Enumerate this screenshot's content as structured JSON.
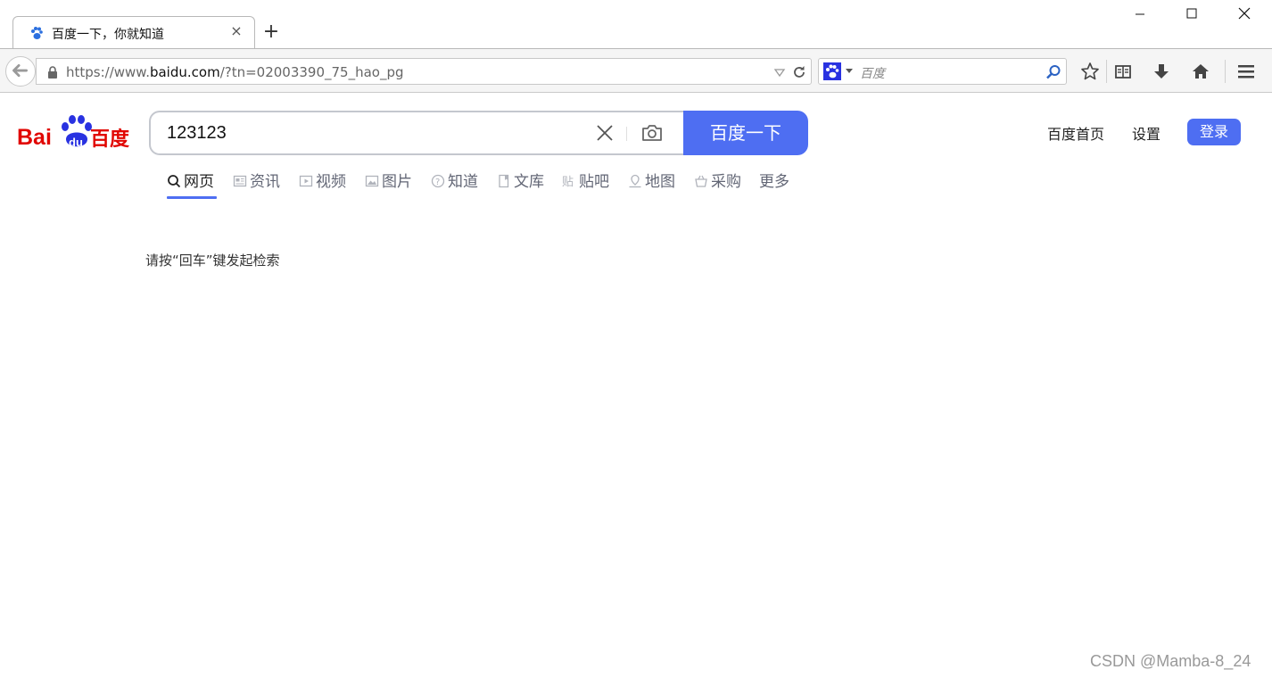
{
  "browser": {
    "tab": {
      "title": "百度一下，你就知道",
      "close_label": "×"
    },
    "new_tab_label": "+",
    "url": {
      "prefix": "https://www.",
      "host": "baidu.com",
      "path": "/?tn=02003390_75_hao_pg"
    },
    "search_bar": {
      "placeholder": "百度"
    },
    "icons": [
      "back-arrow-icon",
      "lock-icon",
      "dropdown-icon",
      "reload-icon",
      "paw-icon",
      "magnifier-icon",
      "star-icon",
      "reading-list-icon",
      "download-icon",
      "home-icon",
      "hamburger-menu-icon"
    ]
  },
  "page": {
    "logo_text": "Bai du 百度",
    "search": {
      "value": "123123",
      "button_label": "百度一下"
    },
    "top_links": {
      "home": "百度首页",
      "settings": "设置",
      "login": "登录"
    },
    "tabs": [
      {
        "label": "网页",
        "icon": "search-icon"
      },
      {
        "label": "资讯",
        "icon": "news-icon"
      },
      {
        "label": "视频",
        "icon": "video-icon"
      },
      {
        "label": "图片",
        "icon": "image-icon"
      },
      {
        "label": "知道",
        "icon": "question-icon"
      },
      {
        "label": "文库",
        "icon": "doc-icon"
      },
      {
        "label": "贴吧",
        "icon": "tieba-icon"
      },
      {
        "label": "地图",
        "icon": "map-icon"
      },
      {
        "label": "采购",
        "icon": "basket-icon"
      },
      {
        "label": "更多",
        "icon": ""
      }
    ],
    "hint": "请按“回车”键发起检索"
  },
  "watermark": "CSDN @Mamba-8_24",
  "colors": {
    "accent": "#4e6ef2",
    "logo_red": "#e10601",
    "logo_blue": "#2932e1"
  }
}
